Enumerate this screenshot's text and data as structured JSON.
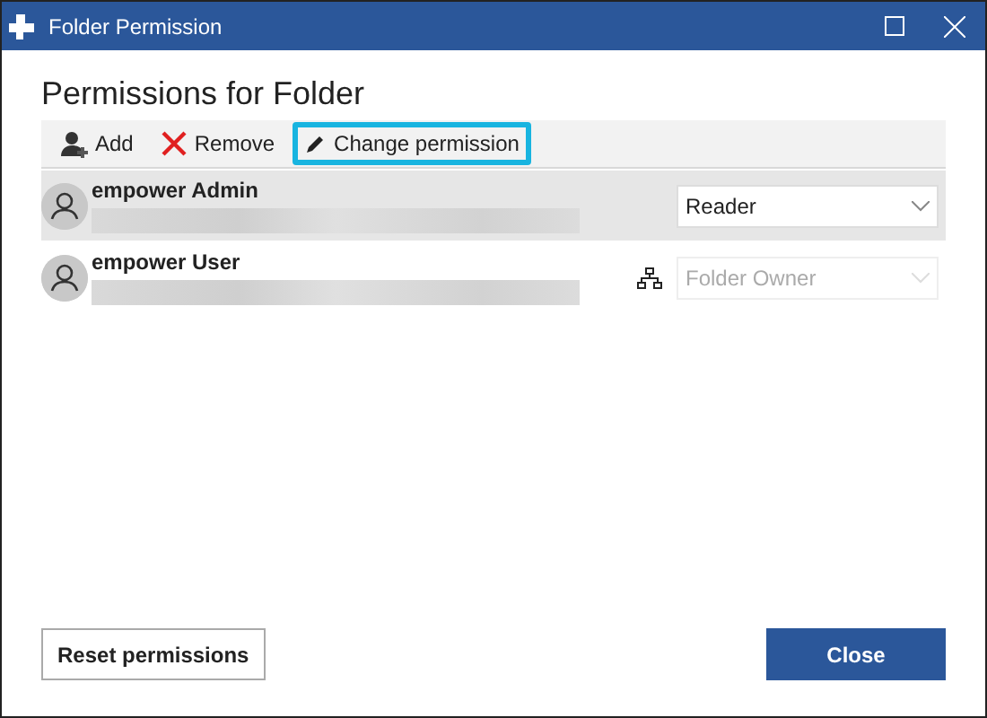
{
  "window": {
    "title": "Folder Permission"
  },
  "heading": "Permissions for Folder",
  "toolbar": [
    {
      "kind": "add",
      "label": "Add",
      "highlighted": false
    },
    {
      "kind": "remove",
      "label": "Remove",
      "highlighted": false
    },
    {
      "kind": "edit",
      "label": "Change permission",
      "highlighted": true
    }
  ],
  "users": [
    {
      "name": "empower Admin",
      "selected": true,
      "inherited": false,
      "disabled": false,
      "permission": "Reader"
    },
    {
      "name": "empower User",
      "selected": false,
      "inherited": true,
      "disabled": true,
      "permission": "Folder Owner"
    }
  ],
  "buttons": [
    {
      "kind": "secondary",
      "label": "Reset permissions"
    },
    {
      "kind": "primary",
      "label": "Close"
    }
  ]
}
